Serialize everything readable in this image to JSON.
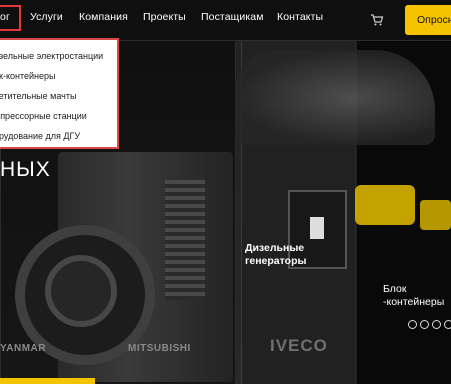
{
  "nav": {
    "items": [
      {
        "label": "ог"
      },
      {
        "label": "Услуги"
      },
      {
        "label": "Компания"
      },
      {
        "label": "Проекты"
      },
      {
        "label": "Постащикам"
      },
      {
        "label": "Контакты"
      }
    ],
    "cta_label": "Опросн",
    "cart_icon": "cart-icon"
  },
  "dropdown": {
    "items": [
      {
        "label": "изельные электростанции"
      },
      {
        "label": "ок-контейнеры"
      },
      {
        "label": "ветительные мачты"
      },
      {
        "label": "мпрессорные станции"
      },
      {
        "label": "орудование для ДГУ"
      }
    ]
  },
  "hero": {
    "fragment": "НЫХ"
  },
  "categories": {
    "diesel": {
      "line1": "Дизельные",
      "line2": "генераторы"
    },
    "block": {
      "line1": "Блок",
      "line2": "-контейнеры"
    }
  },
  "brands": {
    "yanmar": "YANMAR",
    "mitsubishi": "MITSUBISHI",
    "iveco": "IVECO"
  },
  "colors": {
    "accent": "#f5c400",
    "highlight": "#e03a3a"
  }
}
